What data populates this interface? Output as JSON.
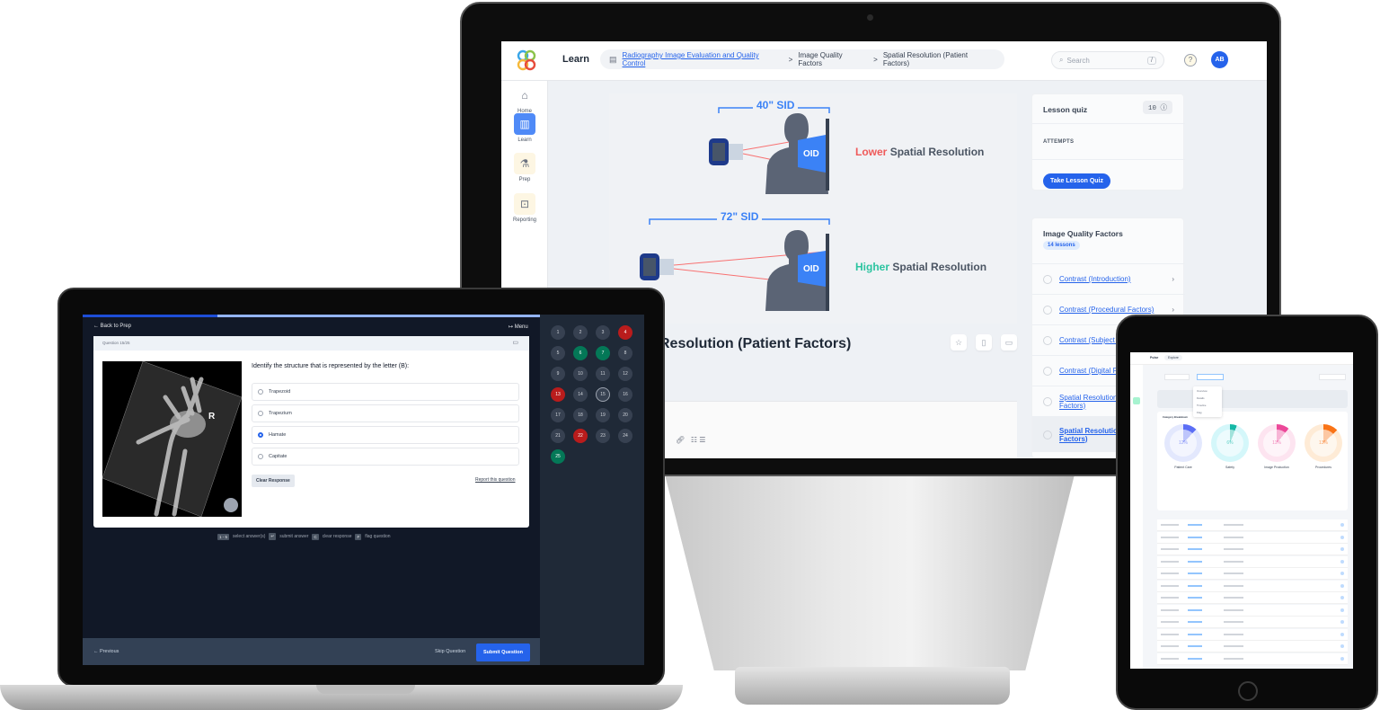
{
  "imac": {
    "app_title": "Learn",
    "breadcrumbs": [
      {
        "label": "Radiography Image Evaluation and Quality Control",
        "link": true
      },
      {
        "label": "Image Quality Factors",
        "link": false
      },
      {
        "label": "Spatial Resolution (Patient Factors)",
        "link": false
      }
    ],
    "breadcrumb_sep": ">",
    "search": {
      "placeholder": "Search",
      "shortcut": "/"
    },
    "help_icon": "question-circle-icon",
    "avatar_initials": "AB",
    "sidenav": [
      {
        "label": "Home",
        "icon": "home-icon",
        "active": false
      },
      {
        "label": "Learn",
        "icon": "book-icon",
        "active": true
      },
      {
        "label": "Prep",
        "icon": "flask-icon",
        "active": false
      },
      {
        "label": "Reporting",
        "icon": "chart-icon",
        "active": false
      }
    ],
    "diagram": {
      "top_sid": "40\" SID",
      "bottom_sid": "72\" SID",
      "oid_label": "OID",
      "lower_word": "Lower",
      "higher_word": "Higher",
      "resolution_suffix": "Spatial Resolution",
      "lower_color": "#ef5a5a",
      "higher_color": "#2bc4a0",
      "accent": "#3b82f6"
    },
    "lesson_title": "Resolution (Patient Factors)",
    "lesson_actions": [
      "star-icon",
      "bookmark-icon",
      "comment-icon"
    ],
    "quiz_card": {
      "title": "Lesson quiz",
      "count": "10",
      "attempts_label": "ATTEMPTS",
      "button": "Take Lesson Quiz"
    },
    "module_card": {
      "title": "Image Quality Factors",
      "badge": "14 lessons",
      "lessons": [
        {
          "label": "Contrast (Introduction)"
        },
        {
          "label": "Contrast (Procedural Factors)"
        },
        {
          "label": "Contrast (Subject Factors)"
        },
        {
          "label": "Contrast (Digital Factors)"
        },
        {
          "label": "Spatial Resolution (Procedural Factors)"
        },
        {
          "label": "Spatial Resolution (Patient Factors)"
        }
      ]
    }
  },
  "laptop": {
    "back": "← Back to Prep",
    "menu": "↦ Menu",
    "progress_fraction": 0.24,
    "question_header": "Question 15/25",
    "question_text": "Identify the structure that is represented by the letter (B):",
    "xray_marker": "R",
    "options": [
      {
        "label": "Trapezoid",
        "selected": false
      },
      {
        "label": "Trapezium",
        "selected": false
      },
      {
        "label": "Hamate",
        "selected": true
      },
      {
        "label": "Capitate",
        "selected": false
      }
    ],
    "clear_button": "Clear Response",
    "report_link": "Report this question",
    "shortcuts": [
      {
        "keys": "1 - 5",
        "label": "select answer(s)"
      },
      {
        "keys": "↵",
        "label": "submit answer"
      },
      {
        "keys": "C",
        "label": "clear response"
      },
      {
        "keys": "F",
        "label": "flag question"
      }
    ],
    "question_nav": [
      {
        "n": "1",
        "s": ""
      },
      {
        "n": "2",
        "s": ""
      },
      {
        "n": "3",
        "s": ""
      },
      {
        "n": "4",
        "s": "red"
      },
      {
        "n": "5",
        "s": ""
      },
      {
        "n": "6",
        "s": "green"
      },
      {
        "n": "7",
        "s": "green"
      },
      {
        "n": "8",
        "s": ""
      },
      {
        "n": "9",
        "s": ""
      },
      {
        "n": "10",
        "s": ""
      },
      {
        "n": "11",
        "s": ""
      },
      {
        "n": "12",
        "s": ""
      },
      {
        "n": "13",
        "s": "red"
      },
      {
        "n": "14",
        "s": ""
      },
      {
        "n": "15",
        "s": "current"
      },
      {
        "n": "16",
        "s": ""
      },
      {
        "n": "17",
        "s": ""
      },
      {
        "n": "18",
        "s": ""
      },
      {
        "n": "19",
        "s": ""
      },
      {
        "n": "20",
        "s": ""
      },
      {
        "n": "21",
        "s": ""
      },
      {
        "n": "22",
        "s": "red"
      },
      {
        "n": "23",
        "s": ""
      },
      {
        "n": "24",
        "s": ""
      },
      {
        "n": "25",
        "s": "green"
      }
    ],
    "previous": "← Previous",
    "skip": "Skip Question",
    "submit": "Submit Question"
  },
  "ipad": {
    "title": "Pulse",
    "tab": "Explore",
    "dropdown_items": [
      "Overview",
      "Details",
      "Timeline",
      "Flag"
    ],
    "section_title": "Category Breakdown",
    "donuts": [
      {
        "label": "Patient Care",
        "value": "12%",
        "color": "#5b6ef5",
        "track": "#e3e8fd"
      },
      {
        "label": "Safety",
        "value": "6%",
        "color": "#14b8a6",
        "track": "#d4f7fa"
      },
      {
        "label": "Image Production",
        "value": "11%",
        "color": "#ec4899",
        "track": "#fde4f0"
      },
      {
        "label": "Procedures",
        "value": "13%",
        "color": "#f97316",
        "track": "#feebd6"
      }
    ]
  }
}
